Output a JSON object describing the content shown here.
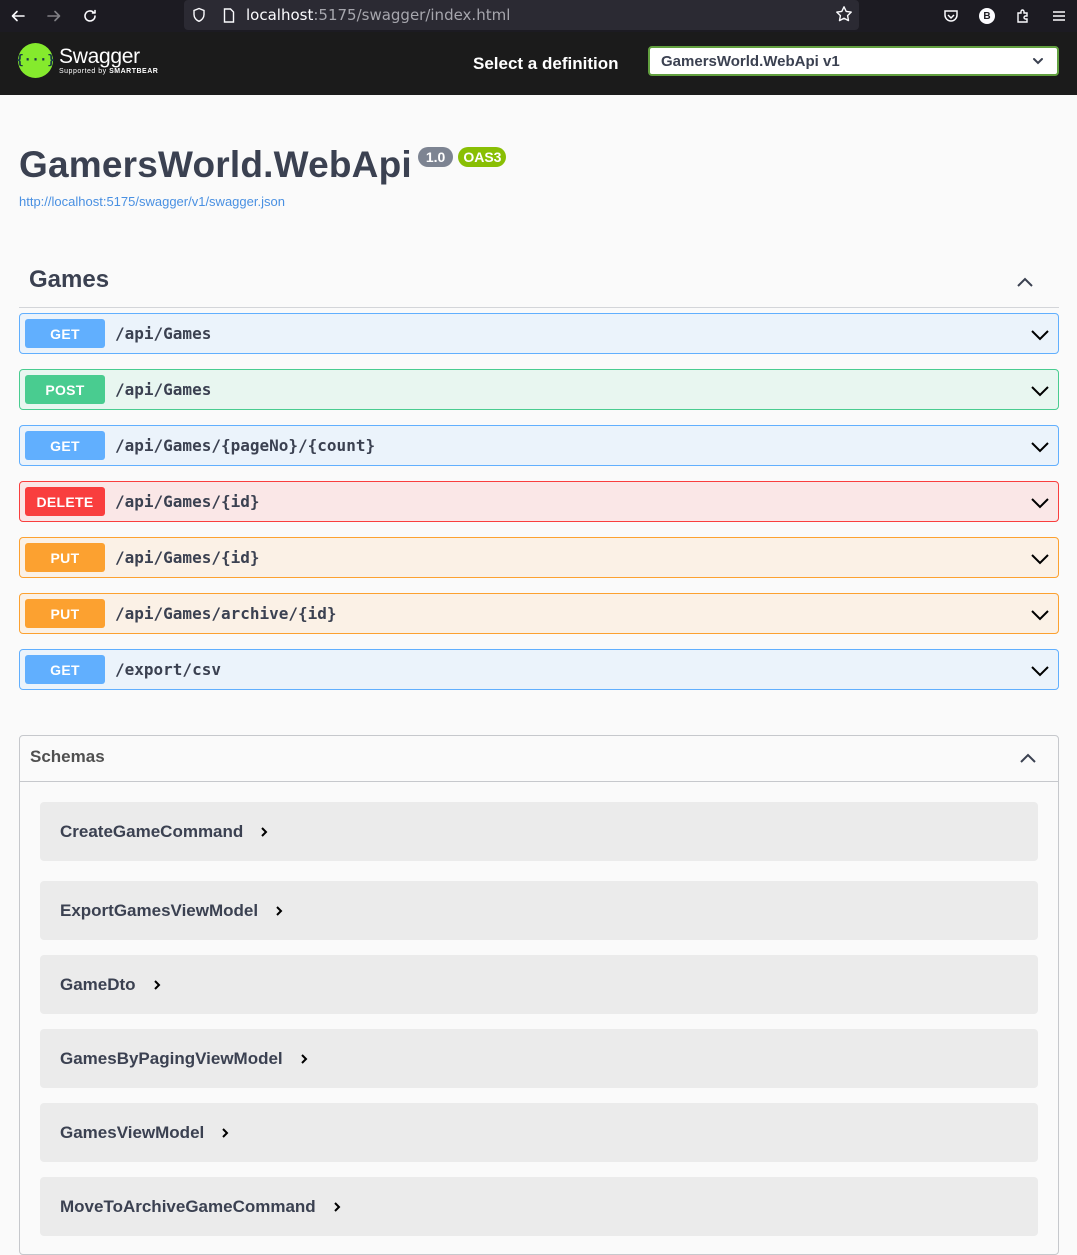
{
  "browser": {
    "url_host": "localhost",
    "url_path": ":5175/swagger/index.html",
    "profile_initial": "B"
  },
  "topbar": {
    "brand": "Swagger",
    "brand_sub_prefix": "Supported by",
    "brand_sub_company": "SMARTBEAR",
    "definition_label": "Select a definition",
    "definition_selected": "GamersWorld.WebApi v1"
  },
  "info": {
    "title": "GamersWorld.WebApi",
    "version": "1.0",
    "oas": "OAS3",
    "spec_url": "http://localhost:5175/swagger/v1/swagger.json"
  },
  "tag": {
    "name": "Games",
    "operations": [
      {
        "method": "GET",
        "path": "/api/Games"
      },
      {
        "method": "POST",
        "path": "/api/Games"
      },
      {
        "method": "GET",
        "path": "/api/Games/{pageNo}/{count}"
      },
      {
        "method": "DELETE",
        "path": "/api/Games/{id}"
      },
      {
        "method": "PUT",
        "path": "/api/Games/{id}"
      },
      {
        "method": "PUT",
        "path": "/api/Games/archive/{id}"
      },
      {
        "method": "GET",
        "path": "/export/csv"
      }
    ]
  },
  "schemas": {
    "title": "Schemas",
    "models": [
      "CreateGameCommand",
      "ExportGamesViewModel",
      "GameDto",
      "GamesByPagingViewModel",
      "GamesViewModel",
      "MoveToArchiveGameCommand"
    ]
  },
  "colors": {
    "get": "#61affe",
    "post": "#49cc90",
    "delete": "#f93e3e",
    "put": "#fca130",
    "topbar": "#1b1b1b",
    "logo": "#85ea2d"
  }
}
